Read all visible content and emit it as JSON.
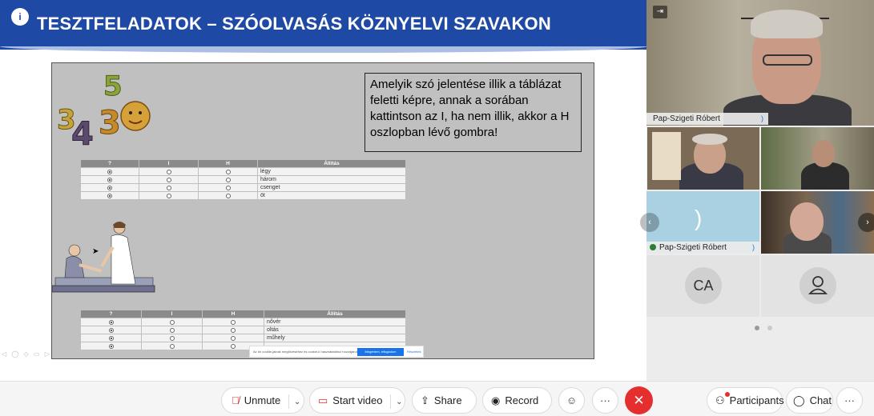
{
  "slide": {
    "title": "TESZTFELADATOK – SZÓOLVASÁS KÖZNYELVI SZAVAKON",
    "info_glyph": "i",
    "instruction": "Amelyik szó jelentése illik a táblázat feletti képre, annak a sorában kattintson az I, ha nem illik, akkor a H oszlopban lévő gombra!",
    "numbers_art": [
      "3",
      "4",
      "5",
      "3",
      "0"
    ],
    "table_headers": [
      "?",
      "I",
      "H",
      "Állítás"
    ],
    "table1_rows": [
      {
        "word": "légy",
        "selected": 0
      },
      {
        "word": "három",
        "selected": 0
      },
      {
        "word": "csenget",
        "selected": 0
      },
      {
        "word": "öt",
        "selected": 0
      }
    ],
    "table2_rows": [
      {
        "word": "nővér",
        "selected": 0
      },
      {
        "word": "oltás",
        "selected": 0
      },
      {
        "word": "műhely",
        "selected": 0
      },
      {
        "word": "",
        "selected": 0
      }
    ],
    "cookie": {
      "text": "Az ön cookie-jainak megőrzéséhez és cookie-k használatához hozzájárul?",
      "accept_label": "Megértem, elfogadom",
      "more_label": "Részletek"
    }
  },
  "participants": {
    "main_name": "Pap-Szigeti Róbert",
    "audio_name": "Pap-Szigeti Róbert",
    "ca_initials": "CA",
    "colors": {
      "speaking": "#2e7d32",
      "audio_bg": "#a9d1e2"
    }
  },
  "toolbar": {
    "unmute_label": "Unmute",
    "video_label": "Start video",
    "share_label": "Share",
    "record_label": "Record",
    "participants_label": "Participants",
    "chat_label": "Chat",
    "more_glyph": "···",
    "colors": {
      "hangup": "#e52e2e",
      "video_icon": "#e52e2e"
    }
  }
}
